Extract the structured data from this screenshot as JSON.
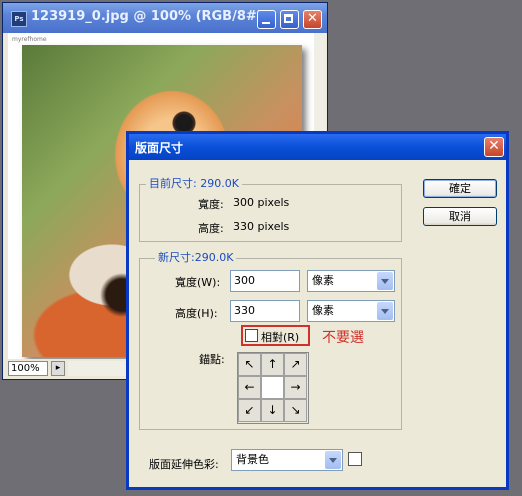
{
  "doc_window": {
    "title": "123919_0.jpg @ 100% (RGB/8#)",
    "icon_text": "Ps",
    "watermark": "myrefhome",
    "zoom": "100%"
  },
  "dialog": {
    "title": "版面尺寸",
    "current_size": {
      "group_label": "目前尺寸: 290.0K",
      "width_label": "寬度:",
      "width_value": "300 pixels",
      "height_label": "高度:",
      "height_value": "330 pixels"
    },
    "new_size": {
      "group_label": "新尺寸:290.0K",
      "width_label": "寬度(W):",
      "width_value": "300",
      "width_unit": "像素",
      "height_label": "高度(H):",
      "height_value": "330",
      "height_unit": "像素",
      "relative_label": "相對(R)",
      "relative_checked": false,
      "annotation": "不要選",
      "anchor_label": "錨點:"
    },
    "extension_color": {
      "label": "版面延伸色彩:",
      "value": "背景色"
    },
    "buttons": {
      "ok": "確定",
      "cancel": "取消"
    }
  },
  "colors": {
    "annotation": "#d0312a",
    "group_label": "#1a4bc0",
    "titlebar": "#0a50d8"
  }
}
